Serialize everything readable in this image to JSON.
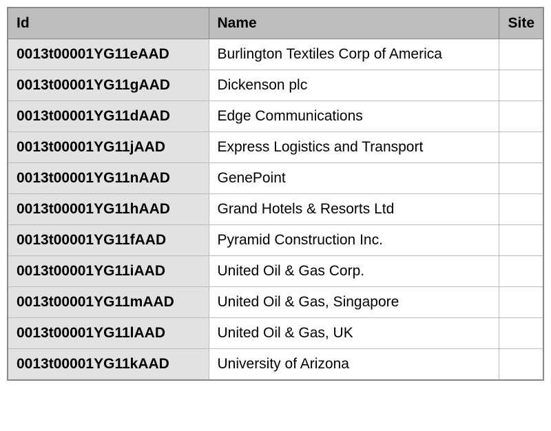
{
  "table": {
    "columns": {
      "id": "Id",
      "name": "Name",
      "site": "Site"
    },
    "rows": [
      {
        "id": "0013t00001YG11eAAD",
        "name": "Burlington Textiles Corp of America",
        "site": ""
      },
      {
        "id": "0013t00001YG11gAAD",
        "name": "Dickenson plc",
        "site": ""
      },
      {
        "id": "0013t00001YG11dAAD",
        "name": "Edge Communications",
        "site": ""
      },
      {
        "id": "0013t00001YG11jAAD",
        "name": "Express Logistics and Transport",
        "site": ""
      },
      {
        "id": "0013t00001YG11nAAD",
        "name": "GenePoint",
        "site": ""
      },
      {
        "id": "0013t00001YG11hAAD",
        "name": "Grand Hotels & Resorts Ltd",
        "site": ""
      },
      {
        "id": "0013t00001YG11fAAD",
        "name": "Pyramid Construction Inc.",
        "site": ""
      },
      {
        "id": "0013t00001YG11iAAD",
        "name": "United Oil & Gas Corp.",
        "site": ""
      },
      {
        "id": "0013t00001YG11mAAD",
        "name": "United Oil & Gas, Singapore",
        "site": ""
      },
      {
        "id": "0013t00001YG11lAAD",
        "name": "United Oil & Gas, UK",
        "site": ""
      },
      {
        "id": "0013t00001YG11kAAD",
        "name": "University of Arizona",
        "site": ""
      }
    ]
  }
}
